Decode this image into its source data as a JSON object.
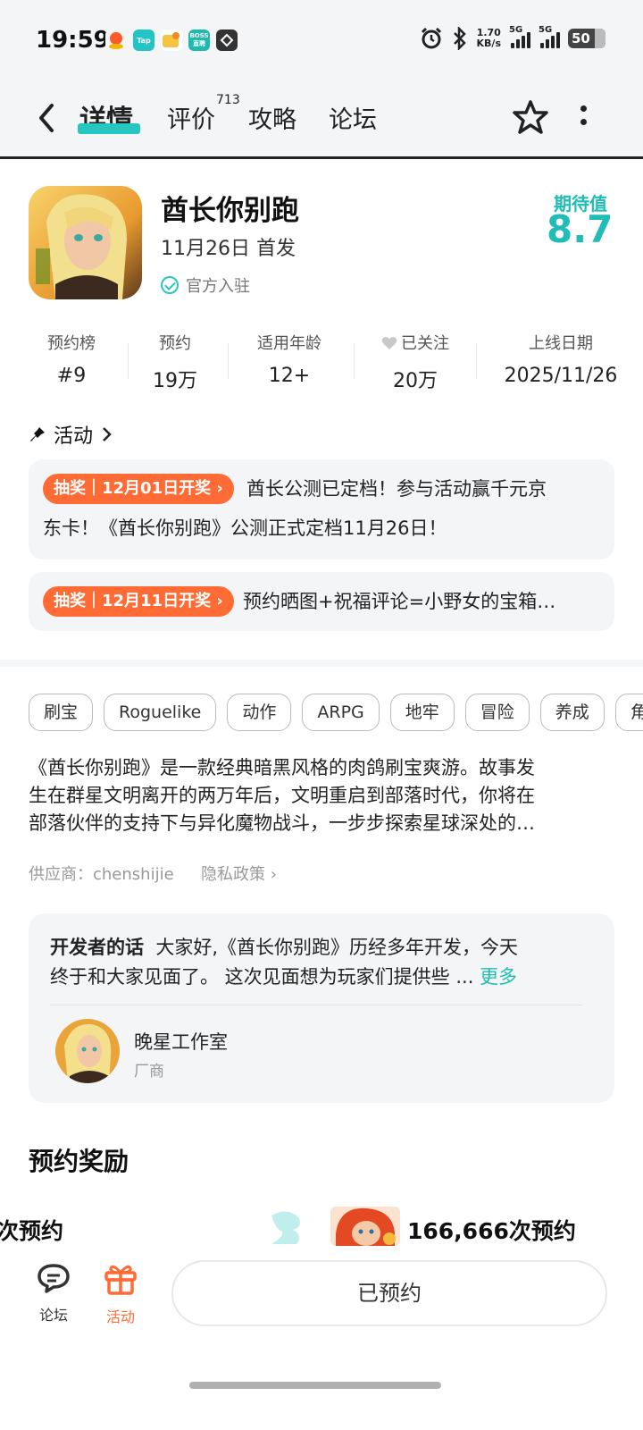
{
  "status": {
    "time": "19:59",
    "speed_value": "1.70",
    "speed_unit": "KB/s",
    "network1": "5G",
    "network2": "5G",
    "battery": "50",
    "app_tap": "Tap",
    "app_boss_line1": "BOSS",
    "app_boss_line2": "直聘"
  },
  "nav": {
    "tabs": [
      "详情",
      "评价",
      "攻略",
      "论坛"
    ],
    "review_count": "713",
    "accent": "#25c7c0"
  },
  "game": {
    "title": "酋长你别跑",
    "release": "11月26日 首发",
    "official": "官方入驻",
    "expect_label": "期待值",
    "expect_score": "8.7"
  },
  "stats": [
    {
      "label": "预约榜",
      "value": "#9"
    },
    {
      "label": "预约",
      "value": "19万"
    },
    {
      "label": "适用年龄",
      "value": "12+"
    },
    {
      "label": "已关注",
      "value": "20万"
    },
    {
      "label": "上线日期",
      "value": "2025/11/26"
    }
  ],
  "activity": {
    "title": "活动",
    "items": [
      {
        "badge": "抽奖｜12月01日开奖",
        "text_line1": "酋长公测已定档！参与活动赢千元京",
        "text_line2": "东卡！《酋长你别跑》公测正式定档11月26日！"
      },
      {
        "badge": "抽奖｜12月11日开奖",
        "text_line1": "预约晒图+祝福评论=小野女的宝箱…"
      }
    ],
    "badge_color": "#ff6b35"
  },
  "tags": [
    "刷宝",
    "Roguelike",
    "动作",
    "ARPG",
    "地牢",
    "冒险",
    "养成",
    "角"
  ],
  "description": {
    "line1": "《酋长你别跑》是一款经典暗黑风格的肉鸽刷宝爽游。故事发",
    "line2": "生在群星文明离开的两万年后，文明重启到部落时代，你将在",
    "line3": "部落伙伴的支持下与异化魔物战斗，一步步探索星球深处的…"
  },
  "supplier": "供应商：chenshijie",
  "privacy": "隐私政策",
  "developer": {
    "label": "开发者的话",
    "text_line1": "大家好,《酋长你别跑》历经多年开发，今天",
    "text_line2": "终于和大家见面了。 这次见面想为玩家们提供些 ...",
    "more": "更多",
    "name": "晚星工作室",
    "role": "厂商"
  },
  "rewards": {
    "title": "预约奖励",
    "left_item": "次预约",
    "right_item": "166,666次预约"
  },
  "bottom": {
    "forum": "论坛",
    "activity": "活动",
    "reserved": "已预约",
    "activity_color": "#ff6b35"
  }
}
